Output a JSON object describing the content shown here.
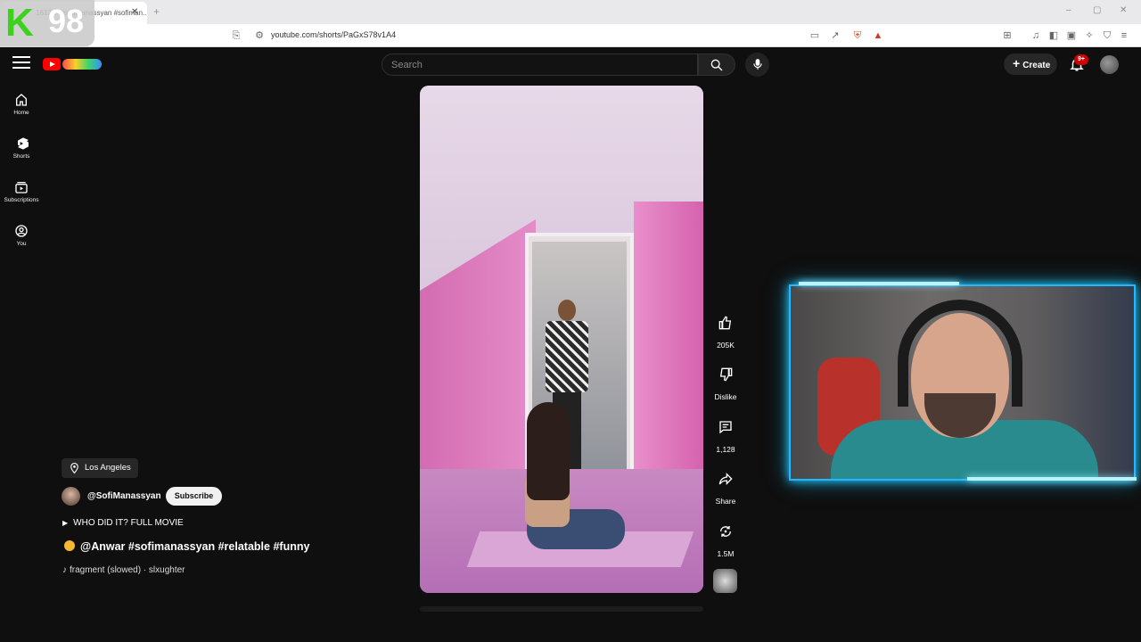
{
  "browser": {
    "tab_title": "1612) · #sofimanassyan #sofiman...",
    "url": "youtube.com/shorts/PaGxS78v1A4"
  },
  "overlay_logo": {
    "letter": "K",
    "number": "98"
  },
  "header": {
    "search_placeholder": "Search",
    "create_label": "Create",
    "notification_badge": "9+"
  },
  "sidebar": {
    "items": [
      {
        "label": "Home",
        "icon": "home-icon"
      },
      {
        "label": "Shorts",
        "icon": "shorts-icon"
      },
      {
        "label": "Subscriptions",
        "icon": "subscriptions-icon"
      },
      {
        "label": "You",
        "icon": "you-icon"
      }
    ]
  },
  "short": {
    "location": "Los Angeles",
    "channel": "@SofiManassyan",
    "subscribe_label": "Subscribe",
    "movie_link": "WHO DID IT? FULL MOVIE",
    "title": "@Anwar #sofimanassyan #relatable #funny",
    "music": "fragment (slowed) · slxughter"
  },
  "actions": {
    "likes": "205K",
    "dislike_label": "Dislike",
    "comments": "1,128",
    "share_label": "Share",
    "remix": "1.5M"
  },
  "colors": {
    "background": "#0f0f0f",
    "cam_border": "#22b8ff",
    "brand_red": "#ff0000"
  }
}
